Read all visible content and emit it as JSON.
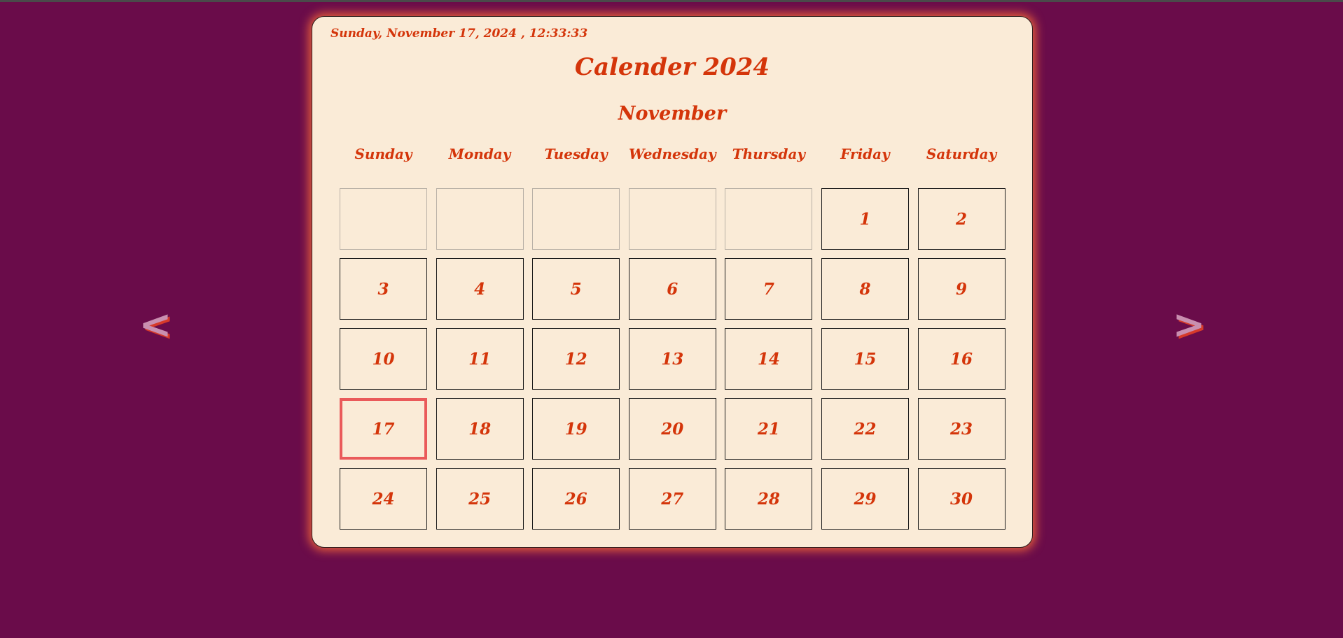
{
  "page": {
    "background": "#6a0c4a",
    "accent": "#d4350a",
    "card_background": "#faebd7",
    "today_border": "#ea5a5a"
  },
  "nav": {
    "prev_label": "<",
    "next_label": ">",
    "prev_icon": "chevron-left-icon",
    "next_icon": "chevron-right-icon"
  },
  "calendar": {
    "clock": "Sunday, November 17, 2024 , 12:33:33",
    "title": "Calender 2024",
    "month": "November",
    "weekdays": [
      "Sunday",
      "Monday",
      "Tuesday",
      "Wednesday",
      "Thursday",
      "Friday",
      "Saturday"
    ],
    "leading_blanks": 5,
    "days": [
      "1",
      "2",
      "3",
      "4",
      "5",
      "6",
      "7",
      "8",
      "9",
      "10",
      "11",
      "12",
      "13",
      "14",
      "15",
      "16",
      "17",
      "18",
      "19",
      "20",
      "21",
      "22",
      "23",
      "24",
      "25",
      "26",
      "27",
      "28",
      "29",
      "30"
    ],
    "today": "17"
  }
}
